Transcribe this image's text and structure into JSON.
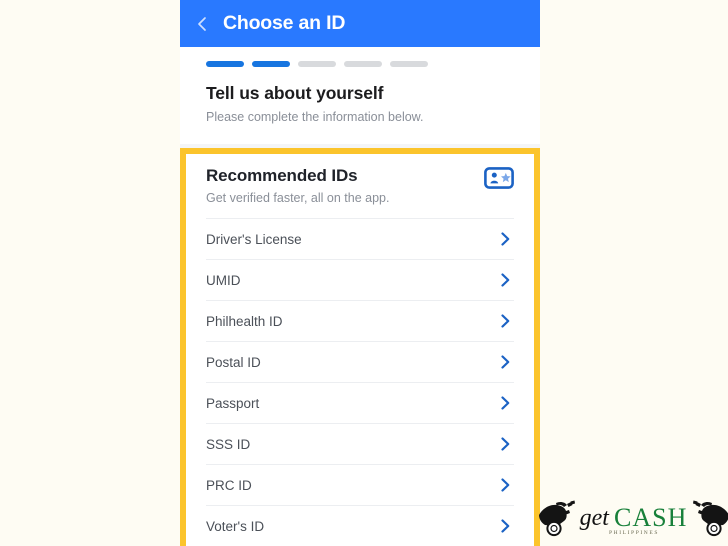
{
  "colors": {
    "page_background": "#fefcf3",
    "appbar_blue": "#2979ff",
    "progress_active": "#1775e0",
    "progress_inactive": "#d8dadd",
    "highlight_yellow": "#fbc42c",
    "chevron_blue": "#1b62c4",
    "logo_green": "#18803a"
  },
  "appbar": {
    "back_icon": "back-chevron-icon",
    "title": "Choose an ID"
  },
  "top_card": {
    "progress": {
      "total": 5,
      "completed": 2,
      "segments": [
        "on",
        "on",
        "off",
        "off",
        "off"
      ]
    },
    "headline": "Tell us about yourself",
    "subheadline": "Please complete the information below."
  },
  "recommended": {
    "title": "Recommended IDs",
    "subtitle": "Get verified faster, all on the app.",
    "badge_icon": "id-card-star-icon",
    "items": [
      {
        "label": "Driver's License",
        "chevron": "chevron-right-icon"
      },
      {
        "label": "UMID",
        "chevron": "chevron-right-icon"
      },
      {
        "label": "Philhealth ID",
        "chevron": "chevron-right-icon"
      },
      {
        "label": "Postal ID",
        "chevron": "chevron-right-icon"
      },
      {
        "label": "Passport",
        "chevron": "chevron-right-icon"
      },
      {
        "label": "SSS ID",
        "chevron": "chevron-right-icon"
      },
      {
        "label": "PRC ID",
        "chevron": "chevron-right-icon"
      },
      {
        "label": "Voter's ID",
        "chevron": "chevron-right-icon"
      }
    ]
  },
  "watermark": {
    "word_get": "get",
    "word_cash": "CASH",
    "tagline": "PHILIPPINES",
    "left_icon": "hand-holding-coin-icon",
    "right_icon": "hand-holding-coin-icon"
  }
}
